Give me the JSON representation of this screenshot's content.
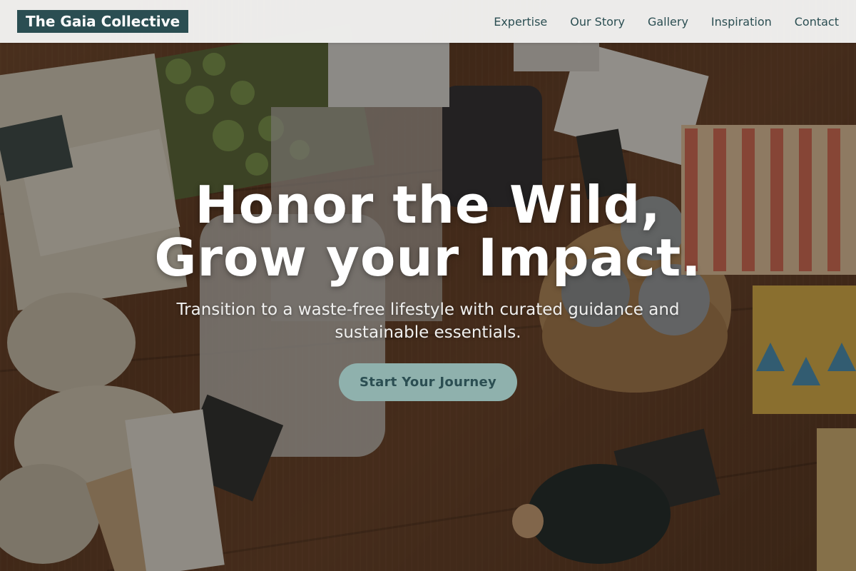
{
  "brand": {
    "name": "The Gaia Collective"
  },
  "nav": {
    "items": [
      {
        "label": "Expertise"
      },
      {
        "label": "Our Story"
      },
      {
        "label": "Gallery"
      },
      {
        "label": "Inspiration"
      },
      {
        "label": "Contact"
      }
    ]
  },
  "hero": {
    "title_line1": "Honor the Wild,",
    "title_line2": "Grow your Impact.",
    "subtitle": "Transition to a waste-free lifestyle with curated guidance and sustainable essentials.",
    "cta_label": "Start Your Journey",
    "background_image": "zero-waste-shop-photo"
  },
  "colors": {
    "brand_bg": "#2b4e52",
    "nav_text": "#2b4e52",
    "cta_bg": "#8fb1ad",
    "cta_text": "#2b4e52",
    "navbar_bg": "#f4f4f3"
  }
}
